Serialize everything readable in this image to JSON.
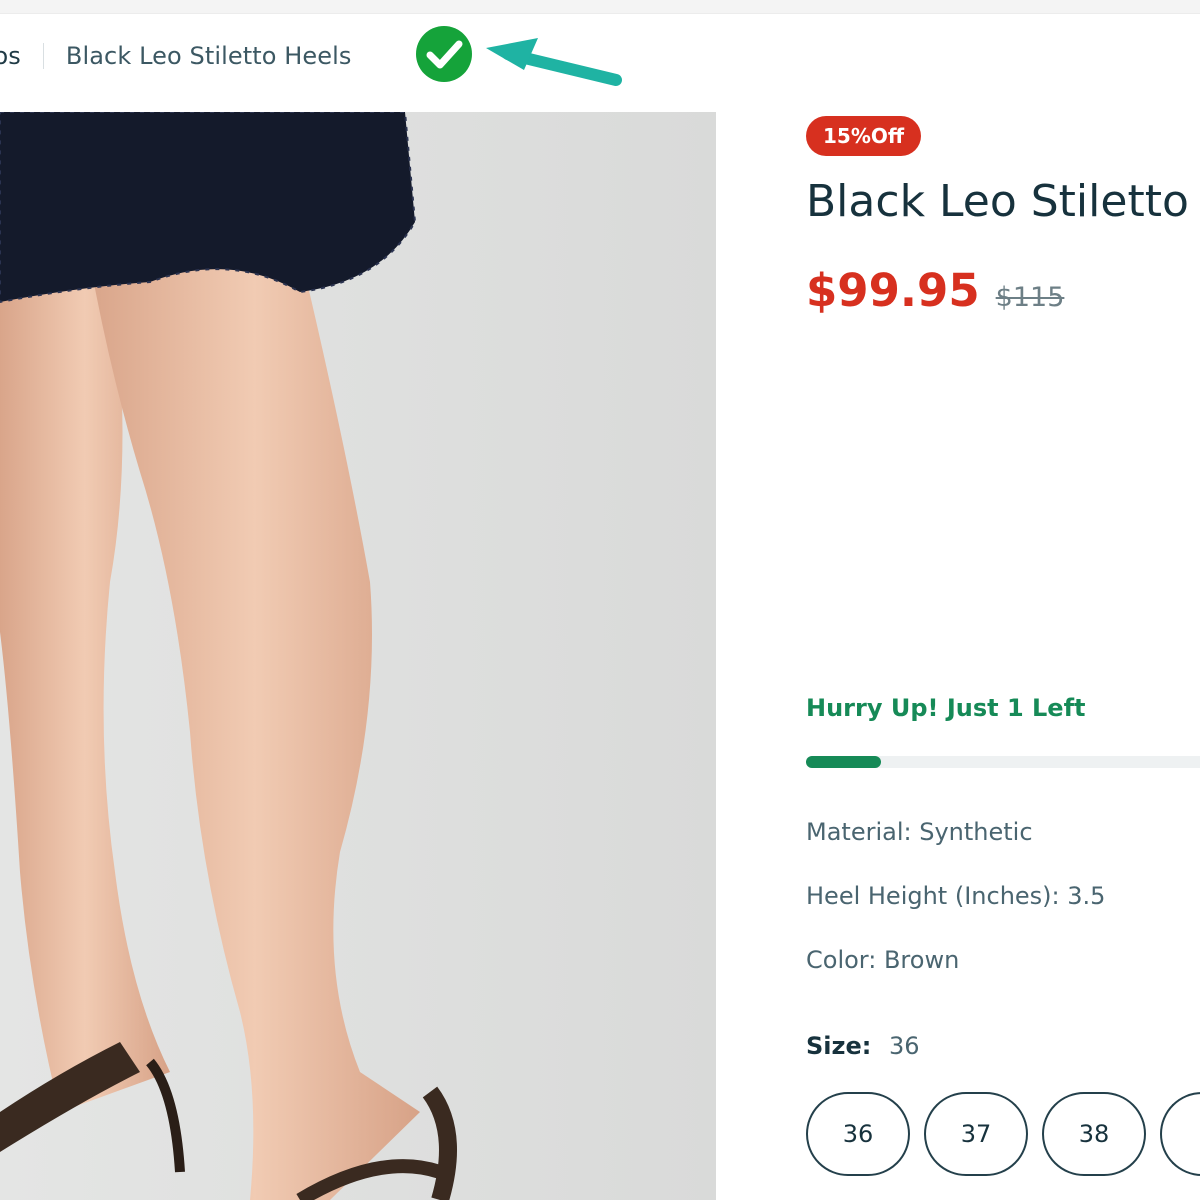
{
  "breadcrumb": {
    "previous": "tos",
    "current": "Black Leo Stiletto Heels"
  },
  "product": {
    "badge": "15%Off",
    "title": "Black Leo Stiletto",
    "price": "$99.95",
    "old_price": "$115"
  },
  "stock": {
    "message": "Hurry Up! Just 1 Left",
    "level": 0.19
  },
  "specs": {
    "material": "Material: Synthetic",
    "heel_height": "Heel Height (Inches): 3.5",
    "color": "Color: Brown"
  },
  "size": {
    "label": "Size:",
    "selected": "36",
    "options": [
      "36",
      "37",
      "38",
      ""
    ]
  },
  "colors": {
    "accent_red": "#d7301f",
    "accent_green": "#168a57",
    "annotation_teal": "#1fb3a3",
    "check_green": "#15a33a"
  },
  "icons": {
    "check": "check-circle-icon",
    "arrow": "annotation-arrow-icon"
  }
}
